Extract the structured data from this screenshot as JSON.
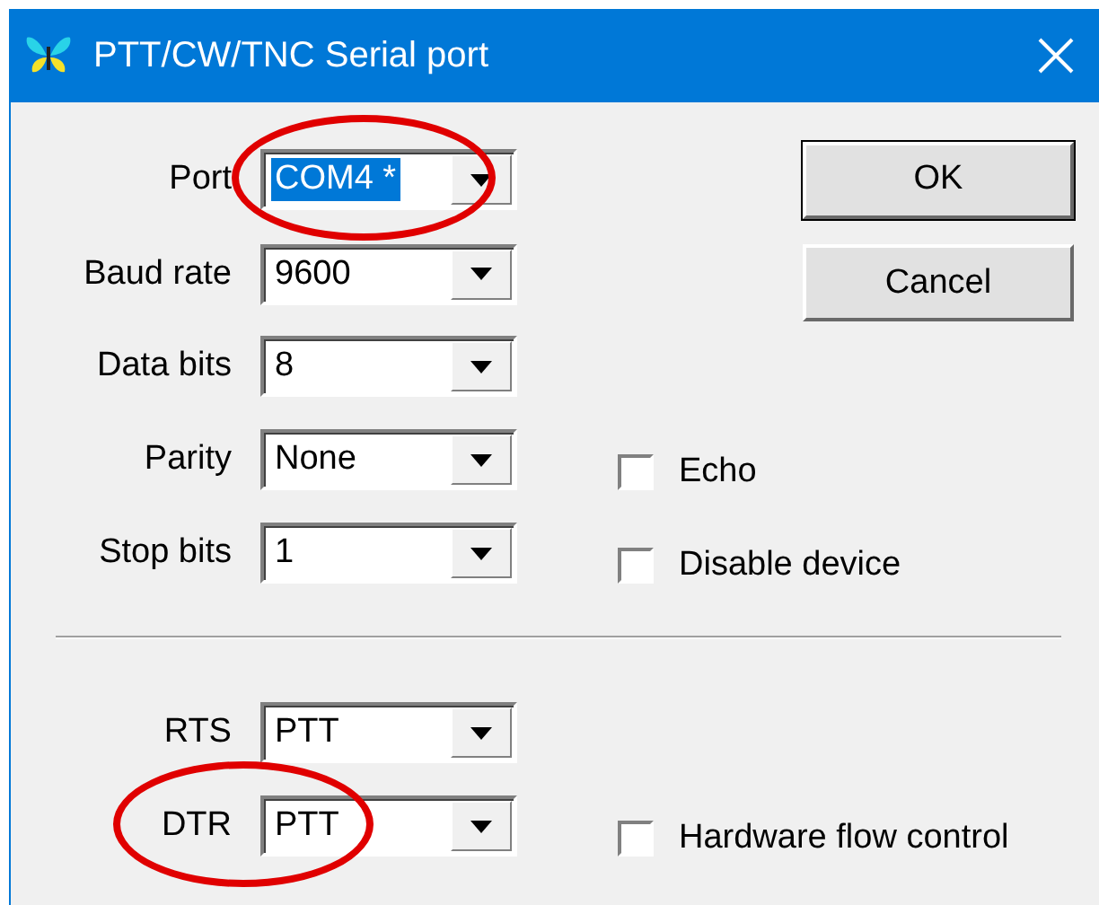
{
  "window": {
    "title": "PTT/CW/TNC Serial port"
  },
  "groups": [
    {
      "fields": [
        {
          "label": "Port",
          "value": "COM4 *",
          "focused": true,
          "value_circled": true,
          "label_circled": false
        },
        {
          "label": "Baud rate",
          "value": "9600",
          "focused": false,
          "value_circled": false,
          "label_circled": false
        },
        {
          "label": "Data bits",
          "value": "8",
          "focused": false,
          "value_circled": false,
          "label_circled": false
        },
        {
          "label": "Parity",
          "value": "None",
          "focused": false,
          "value_circled": false,
          "label_circled": false,
          "checkbox": {
            "label": "Echo",
            "checked": false
          }
        },
        {
          "label": "Stop bits",
          "value": "1",
          "focused": false,
          "value_circled": false,
          "label_circled": false,
          "checkbox": {
            "label": "Disable device",
            "checked": false
          }
        }
      ]
    },
    {
      "fields": [
        {
          "label": "RTS",
          "value": "PTT",
          "focused": false,
          "value_circled": false,
          "label_circled": false
        },
        {
          "label": "DTR",
          "value": "PTT",
          "focused": false,
          "value_circled": true,
          "label_circled": true,
          "checkbox": {
            "label": "Hardware flow control",
            "checked": false
          }
        }
      ]
    }
  ],
  "buttons": [
    {
      "label": "OK",
      "default": true
    },
    {
      "label": "Cancel",
      "default": false
    }
  ]
}
